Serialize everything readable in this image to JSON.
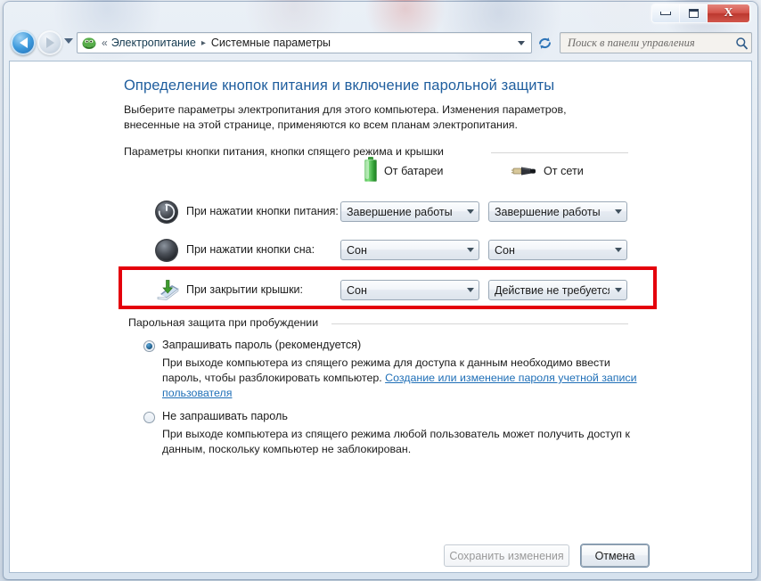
{
  "window": {
    "caption_buttons": [
      {
        "name": "minimize",
        "label": "–"
      },
      {
        "name": "maximize",
        "label": "□"
      },
      {
        "name": "close",
        "label": "X"
      }
    ]
  },
  "navbar": {
    "back_tooltip": "Назад",
    "forward_tooltip": "Вперед",
    "breadcrumb_prefix": "«",
    "breadcrumbs": [
      "Электропитание",
      "Системные параметры"
    ],
    "separator": "▸",
    "search_placeholder": "Поиск в панели управления"
  },
  "page": {
    "title": "Определение кнопок питания и включение парольной защиты",
    "description": "Выберите параметры электропитания для этого компьютера. Изменения параметров, внесенные на этой странице, применяются ко всем планам электропитания."
  },
  "buttons_group": {
    "label": "Параметры кнопки питания, кнопки спящего режима и крышки",
    "columns": [
      {
        "icon": "battery-icon",
        "label": "От батареи"
      },
      {
        "icon": "power-plug-icon",
        "label": "От сети"
      }
    ],
    "rows": [
      {
        "icon": "power-button-icon",
        "label": "При нажатии кнопки питания:",
        "battery_value": "Завершение работы",
        "ac_value": "Завершение работы"
      },
      {
        "icon": "sleep-button-icon",
        "label": "При нажатии кнопки сна:",
        "battery_value": "Сон",
        "ac_value": "Сон"
      },
      {
        "icon": "laptop-lid-icon",
        "label": "При закрытии крышки:",
        "battery_value": "Сон",
        "ac_value": "Действие не требуется"
      }
    ]
  },
  "password_group": {
    "label": "Парольная защита при пробуждении",
    "options": [
      {
        "selected": true,
        "title": "Запрашивать пароль (рекомендуется)",
        "desc_before": "При выходе компьютера из спящего режима для доступа к данным необходимо ввести пароль, чтобы разблокировать компьютер. ",
        "link": "Создание или изменение пароля учетной записи пользователя"
      },
      {
        "selected": false,
        "title": "Не запрашивать пароль",
        "desc_before": "При выходе компьютера из спящего режима любой пользователь может получить доступ к данным, поскольку компьютер не заблокирован.",
        "link": ""
      }
    ]
  },
  "footer": {
    "save_label": "Сохранить изменения",
    "save_enabled": false,
    "cancel_label": "Отмена"
  },
  "annotation": {
    "color": "#e4000b",
    "targets": "При закрытии крышки"
  }
}
